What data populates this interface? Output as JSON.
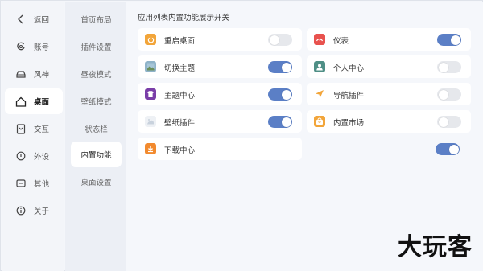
{
  "sidebar": {
    "items": [
      {
        "label": "返回",
        "icon": "back-icon"
      },
      {
        "label": "账号",
        "icon": "account-icon"
      },
      {
        "label": "风神",
        "icon": "car-icon"
      },
      {
        "label": "桌面",
        "icon": "home-icon",
        "active": true
      },
      {
        "label": "交互",
        "icon": "interaction-icon"
      },
      {
        "label": "外设",
        "icon": "peripheral-icon"
      },
      {
        "label": "其他",
        "icon": "other-icon"
      },
      {
        "label": "关于",
        "icon": "info-icon"
      }
    ]
  },
  "subnav": {
    "items": [
      {
        "label": "首页布局"
      },
      {
        "label": "插件设置"
      },
      {
        "label": "昼夜模式"
      },
      {
        "label": "壁纸模式"
      },
      {
        "label": "状态栏"
      },
      {
        "label": "内置功能",
        "active": true
      },
      {
        "label": "桌面设置"
      }
    ]
  },
  "main": {
    "title": "应用列表内置功能展示开关",
    "items": [
      {
        "label": "重启桌面",
        "icon": "restart-icon",
        "on": false
      },
      {
        "label": "仪表",
        "icon": "gauge-icon",
        "on": true
      },
      {
        "label": "切换主题",
        "icon": "theme-switch-icon",
        "on": true
      },
      {
        "label": "个人中心",
        "icon": "profile-icon",
        "on": false
      },
      {
        "label": "主题中心",
        "icon": "theme-center-icon",
        "on": true
      },
      {
        "label": "导航插件",
        "icon": "navigation-icon",
        "on": false
      },
      {
        "label": "壁纸插件",
        "icon": "wallpaper-icon",
        "on": true
      },
      {
        "label": "内置市场",
        "icon": "market-icon",
        "on": false
      },
      {
        "label": "下载中心",
        "icon": "download-icon",
        "on": true
      }
    ]
  },
  "watermark": "大玩客",
  "colors": {
    "accent": "#5b7fc6",
    "toggle_off": "#e6e8ec"
  }
}
